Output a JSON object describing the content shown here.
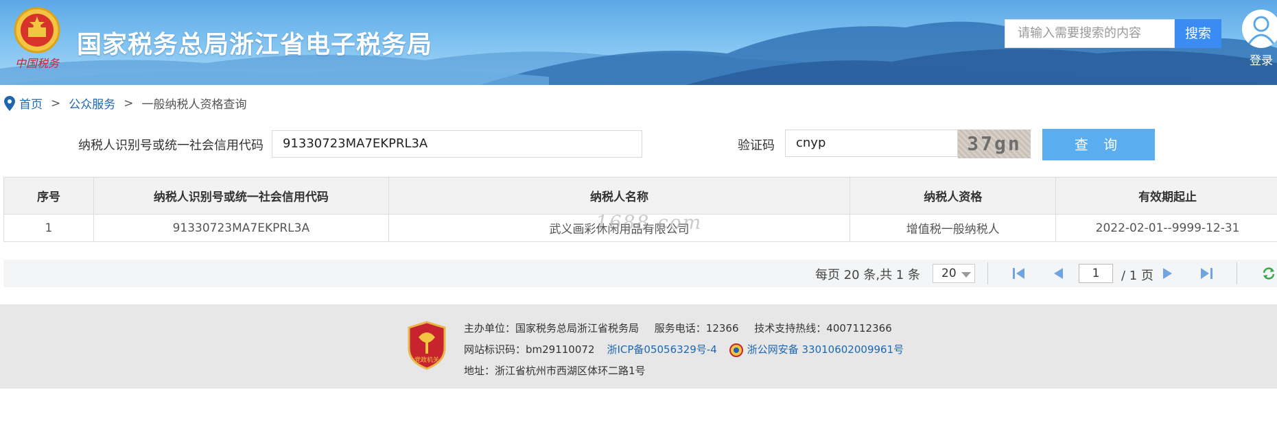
{
  "header": {
    "site_title": "国家税务总局浙江省电子税务局",
    "search_placeholder": "请输入需要搜索的内容",
    "search_button": "搜索",
    "login_label": "登录"
  },
  "breadcrumb": {
    "home": "首页",
    "sep": ">",
    "public_service": "公众服务",
    "current": "一般纳税人资格查询"
  },
  "query_form": {
    "taxpayer_id_label": "纳税人识别号或统一社会信用代码",
    "taxpayer_id_value": "91330723MA7EKPRL3A",
    "captcha_label": "验证码",
    "captcha_value": "cnyp",
    "captcha_image_text": "37gn",
    "query_button": "查 询"
  },
  "result_table": {
    "headers": [
      "序号",
      "纳税人识别号或统一社会信用代码",
      "纳税人名称",
      "纳税人资格",
      "有效期起止"
    ],
    "rows": [
      [
        "1",
        "91330723MA7EKPRL3A",
        "武义画彩休闲用品有限公司",
        "增值税一般纳税人",
        "2022-02-01--9999-12-31"
      ]
    ]
  },
  "watermark": "1688.com",
  "pagination": {
    "summary": "每页 20 条,共 1 条",
    "page_size": "20",
    "current_page": "1",
    "total_pages": "/ 1 页"
  },
  "footer": {
    "host_label": "主办单位：国家税务总局浙江省税务局",
    "service_phone": "服务电话：12366",
    "support_hotline": "技术支持热线：4007112366",
    "site_code": "网站标识码：bm29110072",
    "icp": "浙ICP备05056329号-4",
    "police_record": "浙公网安备 33010602009961号",
    "address": "地址：浙江省杭州市西湖区体环二路1号",
    "badge_text": "党政机关"
  },
  "colors": {
    "accent_blue": "#3b8cf2",
    "query_button": "#5aaef0",
    "link_blue": "#1e67b0",
    "footer_bg": "#e7e7e7"
  },
  "icons": [
    "national-emblem-icon",
    "user-icon",
    "location-pin-icon",
    "first-page-icon",
    "prev-page-icon",
    "next-page-icon",
    "last-page-icon",
    "refresh-icon",
    "party-government-badge-icon",
    "police-badge-icon"
  ]
}
